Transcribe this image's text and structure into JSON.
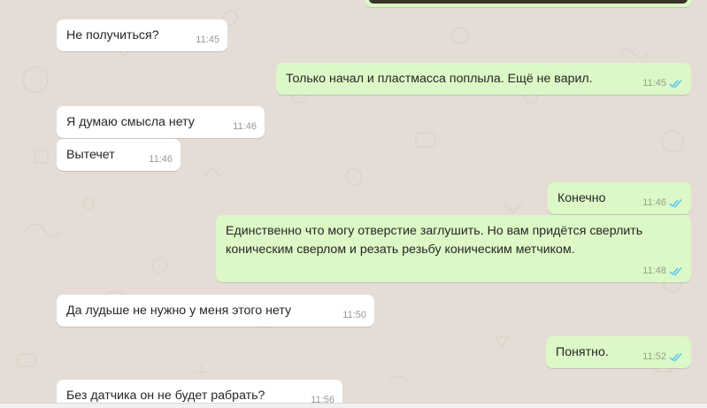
{
  "theme": {
    "incoming_bg": "#ffffff",
    "outgoing_bg": "#dcf8c6",
    "read_tick": "#4fc3f7",
    "wallpaper": "#e5ddd5"
  },
  "messages": [
    {
      "direction": "in",
      "text": "Не получиться?",
      "time": "11:45"
    },
    {
      "direction": "out",
      "text": "Только начал и пластмасса поплыла. Ещё не варил.",
      "time": "11:45",
      "status": "read"
    },
    {
      "direction": "in",
      "text": "Я думаю смысла нету",
      "time": "11:46"
    },
    {
      "direction": "in",
      "text": "Вытечет",
      "time": "11:46"
    },
    {
      "direction": "out",
      "text": "Конечно",
      "time": "11:46",
      "status": "read"
    },
    {
      "direction": "out",
      "text": "Единственно что могу отверстие заглушить. Но вам придётся сверлить коническим сверлом и резать резьбу коническим метчиком.",
      "time": "11:48",
      "status": "read"
    },
    {
      "direction": "in",
      "text": "Да лудьше не нужно у меня этого нету",
      "time": "11:50"
    },
    {
      "direction": "out",
      "text": "Понятно.",
      "time": "11:52",
      "status": "read"
    },
    {
      "direction": "in",
      "text": "Без датчика он не будет рабрать?",
      "time": "11:56"
    }
  ]
}
